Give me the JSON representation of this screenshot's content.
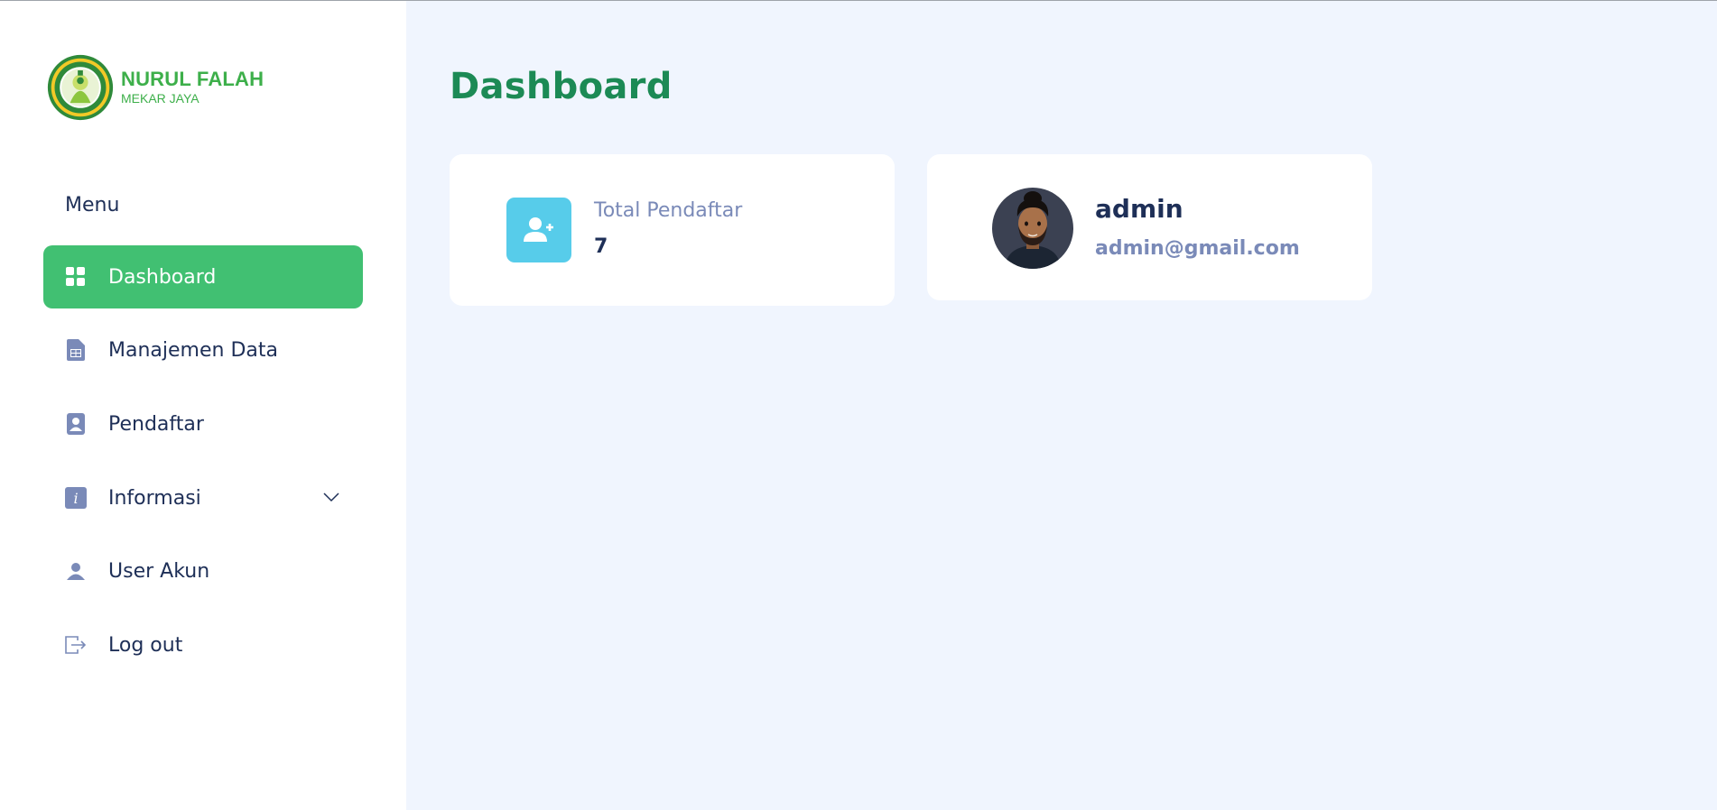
{
  "brand": {
    "name": "NURUL FALAH",
    "subtitle": "MEKAR JAYA",
    "color": "#3daf4a"
  },
  "sidebar": {
    "heading": "Menu",
    "items": [
      {
        "label": "Dashboard",
        "icon": "grid-icon",
        "active": true
      },
      {
        "label": "Manajemen Data",
        "icon": "spreadsheet-file-icon",
        "active": false
      },
      {
        "label": "Pendaftar",
        "icon": "contact-book-icon",
        "active": false
      },
      {
        "label": "Informasi",
        "icon": "info-icon",
        "active": false,
        "expandable": true
      },
      {
        "label": "User Akun",
        "icon": "user-icon",
        "active": false
      },
      {
        "label": "Log out",
        "icon": "logout-icon",
        "active": false
      }
    ],
    "active_color": "#41c072"
  },
  "main": {
    "title": "Dashboard",
    "stats_card": {
      "label": "Total Pendaftar",
      "value": "7",
      "icon": "add-user-icon",
      "icon_bg": "#57ccea"
    },
    "user_card": {
      "name": "admin",
      "email": "admin@gmail.com",
      "avatar": "avatar-image"
    }
  },
  "colors": {
    "page_bg": "#f0f5fe",
    "title": "#1c8a55",
    "text_dark": "#1e2f57",
    "text_muted": "#7a8ab8"
  }
}
